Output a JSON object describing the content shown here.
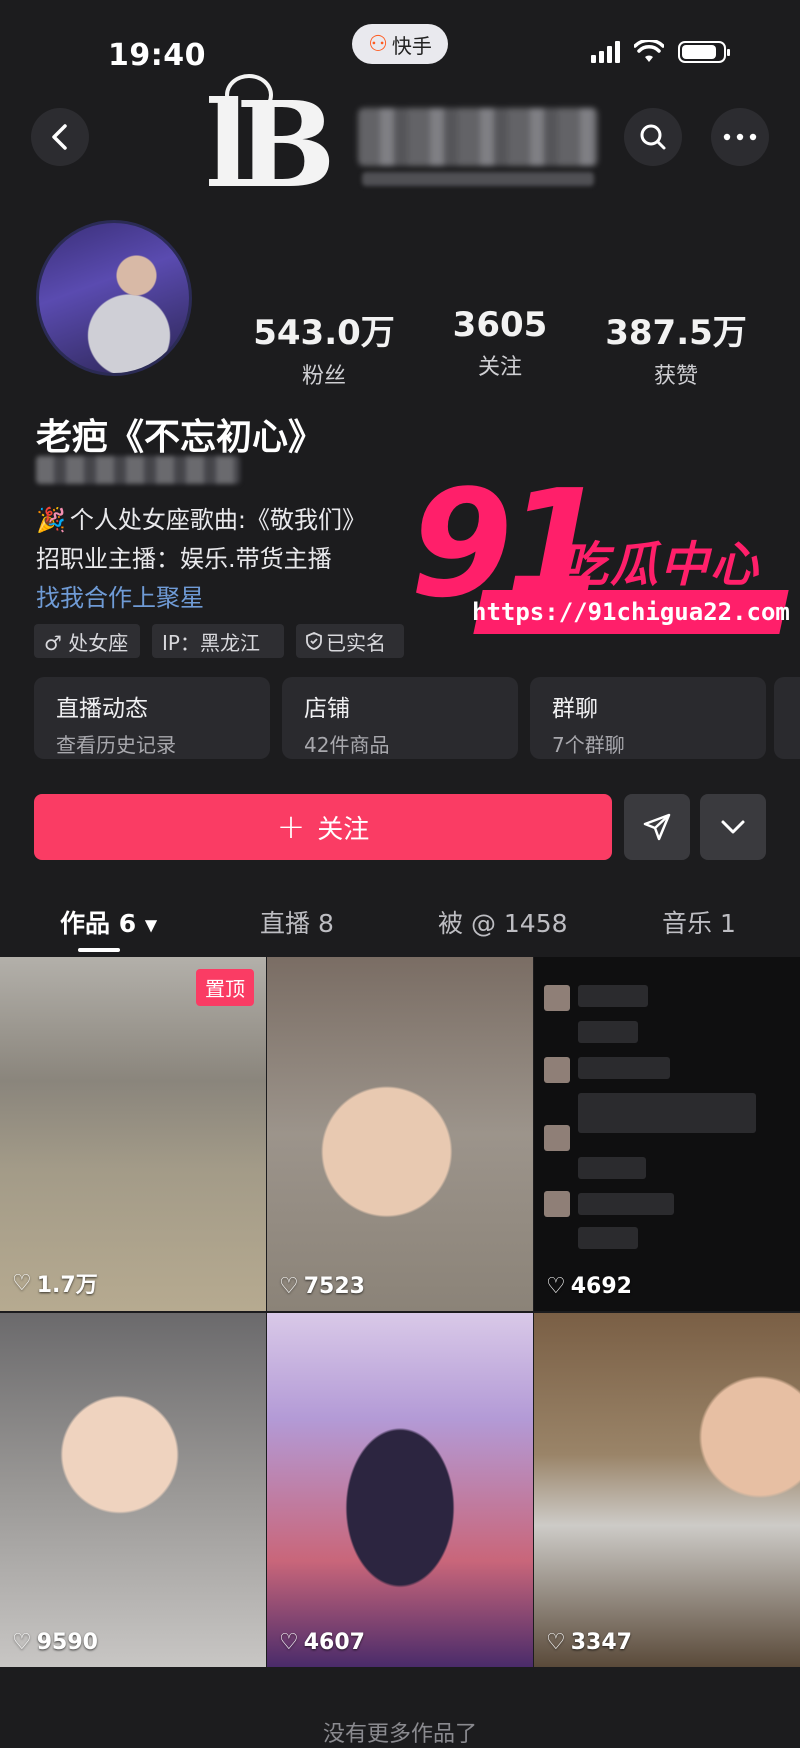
{
  "status_bar": {
    "time": "19:40",
    "app_label": "快手",
    "app_logo_icon": "kuaishou-logo-icon",
    "battery_level": 0.85
  },
  "profile": {
    "nickname": "老疤《不忘初心》",
    "stats": [
      {
        "value": "543.0万",
        "label": "粉丝"
      },
      {
        "value": "3605",
        "label": "关注"
      },
      {
        "value": "387.5万",
        "label": "获赞"
      }
    ],
    "bio": [
      "个人处女座歌曲:《敬我们》",
      "招职业主播：娱乐.带货主播",
      "找我合作上聚星"
    ],
    "tags": [
      "♂ 处女座",
      "IP：黑龙江",
      "已实名"
    ]
  },
  "cards": [
    {
      "title": "直播动态",
      "subtitle": "查看历史记录"
    },
    {
      "title": "店铺",
      "subtitle": "42件商品"
    },
    {
      "title": "群聊",
      "subtitle": "7个群聊"
    }
  ],
  "actions": {
    "follow_label": "关注"
  },
  "tabs": [
    {
      "label": "作品 6"
    },
    {
      "label": "直播 8"
    },
    {
      "label": "被 @ 1458"
    },
    {
      "label": "音乐 1"
    }
  ],
  "videos": [
    {
      "likes": "1.7万",
      "pinned_label": "置顶"
    },
    {
      "likes": "7523"
    },
    {
      "likes": "4692"
    },
    {
      "likes": "9590"
    },
    {
      "likes": "4607"
    },
    {
      "likes": "3347"
    }
  ],
  "watermark": {
    "number": "91",
    "text": "吃瓜中心",
    "url": "https://91chigua22.com"
  },
  "footer_text": "没有更多作品了",
  "colors": {
    "background": "#1c1c1e",
    "accent": "#fa3c64",
    "link": "#6f9bd6",
    "watermark": "#ff1f6a"
  }
}
